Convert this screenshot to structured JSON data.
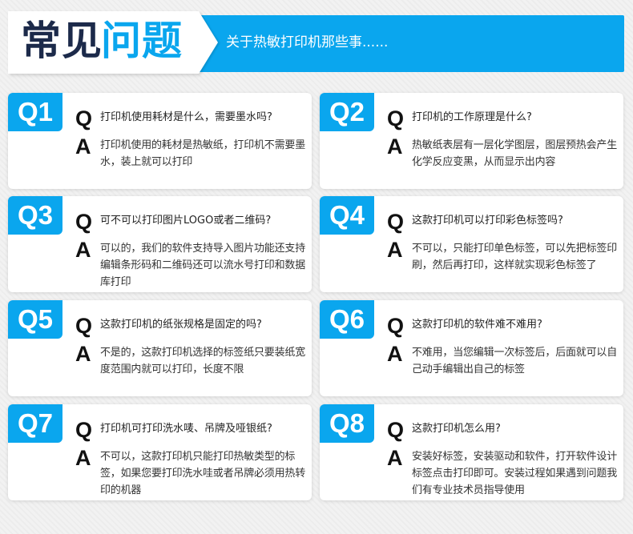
{
  "header": {
    "title_dark": "常见",
    "title_blue": "问题",
    "subtitle": "关于热敏打印机那些事......",
    "accent_color": "#0aa6ee"
  },
  "faq": [
    {
      "tag": "Q1",
      "q_letter": "Q",
      "a_letter": "A",
      "question": "打印机使用耗材是什么，需要墨水吗?",
      "answer": "打印机使用的耗材是热敏纸，打印机不需要墨水，装上就可以打印"
    },
    {
      "tag": "Q2",
      "q_letter": "Q",
      "a_letter": "A",
      "question": "打印机的工作原理是什么?",
      "answer": "热敏纸表层有一层化学图层，图层预热会产生化学反应变黑，从而显示出内容"
    },
    {
      "tag": "Q3",
      "q_letter": "Q",
      "a_letter": "A",
      "question": "可不可以打印图片LOGO或者二维码?",
      "answer": "可以的，我们的软件支持导入图片功能还支持编辑条形码和二维码还可以流水号打印和数据库打印"
    },
    {
      "tag": "Q4",
      "q_letter": "Q",
      "a_letter": "A",
      "question": "这款打印机可以打印彩色标签吗?",
      "answer": "不可以，只能打印单色标签，可以先把标签印刷，然后再打印，这样就实现彩色标签了"
    },
    {
      "tag": "Q5",
      "q_letter": "Q",
      "a_letter": "A",
      "question": "这款打印机的纸张规格是固定的吗?",
      "answer": "不是的，这款打印机选择的标签纸只要装纸宽度范围内就可以打印，长度不限"
    },
    {
      "tag": "Q6",
      "q_letter": "Q",
      "a_letter": "A",
      "question": "这款打印机的软件难不难用?",
      "answer": "不难用，当您编辑一次标签后，后面就可以自己动手编辑出自己的标签"
    },
    {
      "tag": "Q7",
      "q_letter": "Q",
      "a_letter": "A",
      "question": "打印机可打印洗水唛、吊牌及哑银纸?",
      "answer": "不可以，这款打印机只能打印热敏类型的标签，如果您要打印洗水哇或者吊牌必须用热转印的机器"
    },
    {
      "tag": "Q8",
      "q_letter": "Q",
      "a_letter": "A",
      "question": "这款打印机怎么用?",
      "answer": "安装好标签，安装驱动和软件，打开软件设计标签点击打印即可。安装过程如果遇到问题我们有专业技术员指导使用"
    }
  ]
}
